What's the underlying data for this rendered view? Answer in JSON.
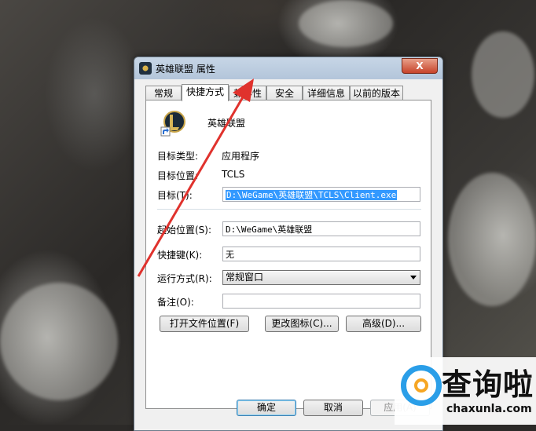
{
  "window": {
    "title": "英雄联盟 属性",
    "close_label": "X"
  },
  "tabs": [
    {
      "label": "常规",
      "active": false
    },
    {
      "label": "快捷方式",
      "active": true
    },
    {
      "label": "兼容性",
      "active": false
    },
    {
      "label": "安全",
      "active": false
    },
    {
      "label": "详细信息",
      "active": false
    },
    {
      "label": "以前的版本",
      "active": false
    }
  ],
  "shortcut": {
    "app_name": "英雄联盟",
    "target_type_label": "目标类型:",
    "target_type_value": "应用程序",
    "target_location_label": "目标位置:",
    "target_location_value": "TCLS",
    "target_label": "目标(T):",
    "target_value": "D:\\WeGame\\英雄联盟\\TCLS\\Client.exe",
    "start_in_label": "起始位置(S):",
    "start_in_value": "D:\\WeGame\\英雄联盟",
    "hotkey_label": "快捷键(K):",
    "hotkey_value": "无",
    "run_label": "运行方式(R):",
    "run_value": "常规窗口",
    "comment_label": "备注(O):",
    "comment_value": ""
  },
  "actions": {
    "open_location": "打开文件位置(F)",
    "change_icon": "更改图标(C)...",
    "advanced": "高级(D)..."
  },
  "footer": {
    "ok": "确定",
    "cancel": "取消",
    "apply": "应用(A)"
  },
  "watermark": {
    "title": "查询啦",
    "url": "chaxunla.com"
  },
  "colors": {
    "annotation_arrow": "#e0322d",
    "selection": "#3399ff",
    "brand_blue": "#2a9ee8",
    "brand_orange": "#f6a623"
  }
}
